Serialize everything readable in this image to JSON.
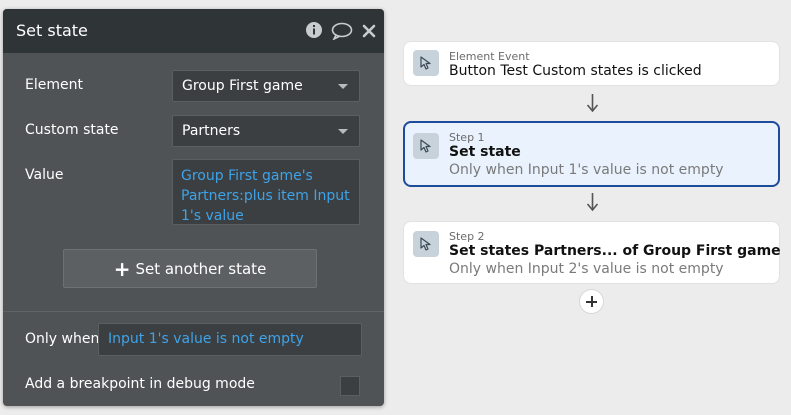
{
  "panel": {
    "title": "Set state",
    "icons": [
      "info-icon",
      "comment-icon",
      "close-icon"
    ],
    "element_label": "Element",
    "element_value": "Group First game",
    "custom_state_label": "Custom state",
    "custom_state_value": "Partners",
    "value_label": "Value",
    "value_text": "Group First game's Partners:plus item Input 1's value",
    "set_another_label": "Set another state",
    "only_when_label": "Only when",
    "only_when_value": "Input 1's value is not empty",
    "breakpoint_label": "Add a breakpoint in debug mode",
    "breakpoint_checked": false
  },
  "workflow": {
    "event": {
      "kicker": "Element Event",
      "title": "Button Test Custom states is clicked",
      "icon": "cursor-icon"
    },
    "steps": [
      {
        "kicker": "Step 1",
        "title": "Set state",
        "condition": "Only when Input 1's value is not empty",
        "selected": true,
        "icon": "cursor-icon"
      },
      {
        "kicker": "Step 2",
        "title": "Set states Partners... of Group First game",
        "condition": "Only when Input 2's value is not empty",
        "selected": false,
        "icon": "cursor-icon"
      }
    ],
    "add_step_icon": "plus-icon"
  },
  "colors": {
    "panel_bg": "#4f5355",
    "panel_header": "#2f3436",
    "expression_blue": "#3ea3e8",
    "selected_border": "#1f4b9c",
    "selected_bg": "#e9f2fd"
  }
}
